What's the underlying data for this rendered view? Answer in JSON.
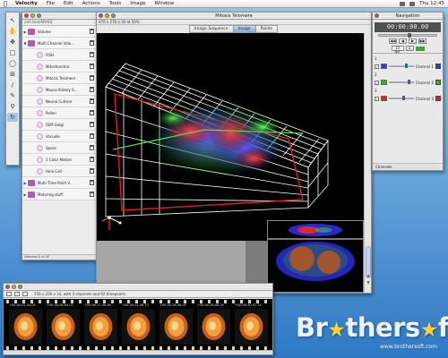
{
  "menubar": {
    "apple": "",
    "items": [
      "Velocity",
      "File",
      "Edit",
      "Actions",
      "Tools",
      "Image",
      "Window"
    ],
    "clock": "Thu 12:45"
  },
  "library": {
    "path": "cell biol/MV02",
    "items": [
      {
        "label": "Volume",
        "kind": "group",
        "child": false,
        "expanded": false
      },
      {
        "label": "Multi Channel Volu...",
        "kind": "group",
        "child": false,
        "expanded": true
      },
      {
        "label": "FISH",
        "kind": "image",
        "child": true
      },
      {
        "label": "Mitochondria",
        "kind": "image",
        "child": true
      },
      {
        "label": "Mitosis Telomere",
        "kind": "image",
        "child": true
      },
      {
        "label": "Mouse Kidney S...",
        "kind": "image",
        "child": true
      },
      {
        "label": "Neural Culture",
        "kind": "image",
        "child": true
      },
      {
        "label": "Pollen",
        "kind": "image",
        "child": true
      },
      {
        "label": "SEM Golgi",
        "kind": "image",
        "child": true
      },
      {
        "label": "Vacuole",
        "kind": "image",
        "child": true
      },
      {
        "label": "Spore",
        "kind": "image",
        "child": true
      },
      {
        "label": "2 Color Motion",
        "kind": "image",
        "child": true
      },
      {
        "label": "Hela Cell",
        "kind": "image",
        "child": true
      },
      {
        "label": "Multi Time Point V...",
        "kind": "group",
        "child": false,
        "expanded": false
      },
      {
        "label": "Motoring stuff",
        "kind": "group",
        "child": false,
        "expanded": false
      }
    ],
    "footer": "selected 0 of 42"
  },
  "image_window": {
    "title": "Mitosis Telomere",
    "subtitle": "476 x 276 x 30 at 50%",
    "tabs": [
      "Image Sequence",
      "Image",
      "Points"
    ],
    "active_tab": "Image",
    "scale_label": "1 Un:1 = 41.8 µm"
  },
  "navigation": {
    "title": "Navigation",
    "timecode": "00:00:00.00",
    "time_slider_fraction": 0.5,
    "fps": "10 fps",
    "channels": [
      {
        "num": "1",
        "label": "Channel 1",
        "color": "#2c3fd6",
        "level_fraction": 0.65
      },
      {
        "num": "2",
        "label": "Channel 2",
        "color": "#2bb82b",
        "level_fraction": 0.75
      },
      {
        "num": "3",
        "label": "Channel 3",
        "color": "#d42626",
        "level_fraction": 0.55
      }
    ],
    "footer": "Channels"
  },
  "filmstrip": {
    "info": "256 x 256 x 14, with 3 channels and 92 timepoints",
    "frames": [
      "+00:00:01.04.00",
      "+00:00:06.64.02",
      "+00:00:17.06.56",
      "+00:00:14.46.73",
      "+00:00:26.06.09",
      "+00:00:26.06.19",
      "+00:00:30.07.24"
    ]
  },
  "watermark": {
    "brand_pre": "Br",
    "brand_mid": "thers",
    "brand_post": "ft",
    "caption": "www.brothersoft.com"
  },
  "colors": {
    "channel1": "#2c3fd6",
    "channel2": "#2bb82b",
    "channel3": "#d42626",
    "desktop": "#6ba9dc"
  },
  "icons": {
    "toolbox": [
      "arrow-icon",
      "hand-icon",
      "move-icon",
      "select-icon",
      "lasso-icon",
      "crop-icon",
      "line-icon",
      "pencil-icon",
      "zoom-icon",
      "rotate-icon"
    ]
  }
}
